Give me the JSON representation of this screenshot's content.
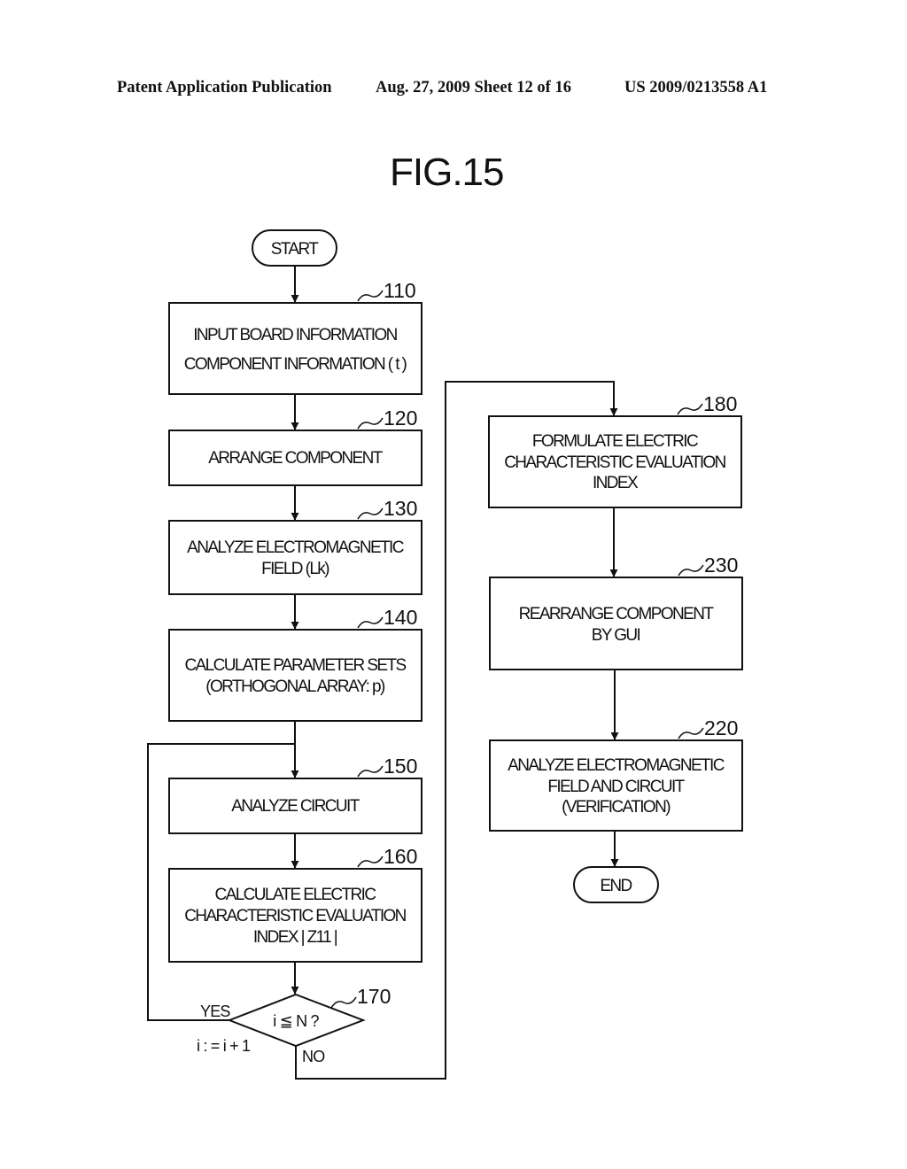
{
  "header": {
    "publication": "Patent Application Publication",
    "date_sheet": "Aug. 27, 2009  Sheet 12 of 16",
    "number": "US 2009/0213558 A1"
  },
  "figure_title": "FIG.15",
  "flowchart": {
    "start": "START",
    "end": "END",
    "steps": {
      "s110": {
        "ref": "110",
        "lines": [
          "INPUT BOARD INFORMATION",
          "COMPONENT INFORMATION ( t )"
        ]
      },
      "s120": {
        "ref": "120",
        "lines": [
          "ARRANGE COMPONENT"
        ]
      },
      "s130": {
        "ref": "130",
        "lines": [
          "ANALYZE ELECTROMAGNETIC",
          "FIELD (Lk)"
        ]
      },
      "s140": {
        "ref": "140",
        "lines": [
          "CALCULATE PARAMETER SETS",
          "(ORTHOGONAL ARRAY: p)"
        ]
      },
      "s150": {
        "ref": "150",
        "lines": [
          "ANALYZE CIRCUIT"
        ]
      },
      "s160": {
        "ref": "160",
        "lines": [
          "CALCULATE ELECTRIC",
          "CHARACTERISTIC EVALUATION",
          "INDEX | Z11 |"
        ]
      },
      "s170": {
        "ref": "170",
        "condition": "i ≦ N ?",
        "yes": "YES",
        "no": "NO",
        "increment": "i : = i + 1"
      },
      "s180": {
        "ref": "180",
        "lines": [
          "FORMULATE ELECTRIC",
          "CHARACTERISTIC EVALUATION",
          "INDEX"
        ]
      },
      "s230": {
        "ref": "230",
        "lines": [
          "REARRANGE COMPONENT",
          "BY GUI"
        ]
      },
      "s220": {
        "ref": "220",
        "lines": [
          "ANALYZE ELECTROMAGNETIC",
          "FIELD AND CIRCUIT",
          "(VERIFICATION)"
        ]
      }
    }
  }
}
